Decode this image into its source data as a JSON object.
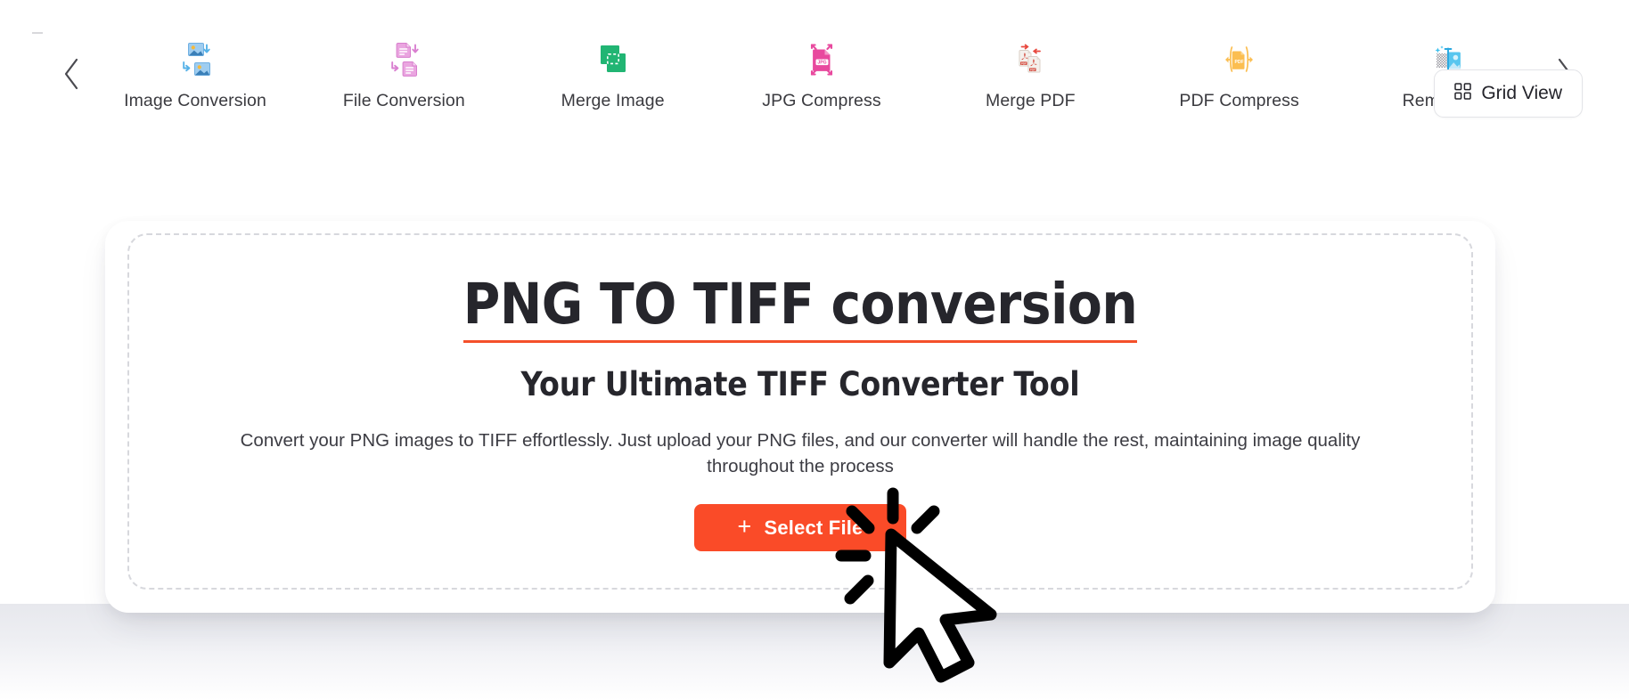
{
  "toolbar": {
    "prev_arrow": "‹",
    "next_arrow": "›",
    "items": [
      {
        "label": "Image Conversion",
        "icon": "image-conversion-icon"
      },
      {
        "label": "File Conversion",
        "icon": "file-conversion-icon"
      },
      {
        "label": "Merge Image",
        "icon": "merge-image-icon"
      },
      {
        "label": "JPG Compress",
        "icon": "jpg-compress-icon"
      },
      {
        "label": "Merge PDF",
        "icon": "merge-pdf-icon"
      },
      {
        "label": "PDF Compress",
        "icon": "pdf-compress-icon"
      },
      {
        "label": "Remove Bg",
        "icon": "remove-bg-icon"
      }
    ],
    "grid_view_label": "Grid View",
    "grid_view_icon": "grid-icon"
  },
  "hero": {
    "title": "PNG TO TIFF conversion",
    "subtitle": "Your Ultimate TIFF Converter Tool",
    "description": "Convert your PNG images to TIFF effortlessly. Just upload your PNG files, and our converter will handle the rest, maintaining image quality throughout the process",
    "select_file_label": "Select File",
    "select_file_plus": "+"
  },
  "colors": {
    "accent": "#fa4b28",
    "title_underline": "#f4502a",
    "text_dark": "#26262c",
    "dashed_border": "#d7d8dd"
  },
  "cursor": {
    "icon": "mouse-pointer-click-icon"
  }
}
